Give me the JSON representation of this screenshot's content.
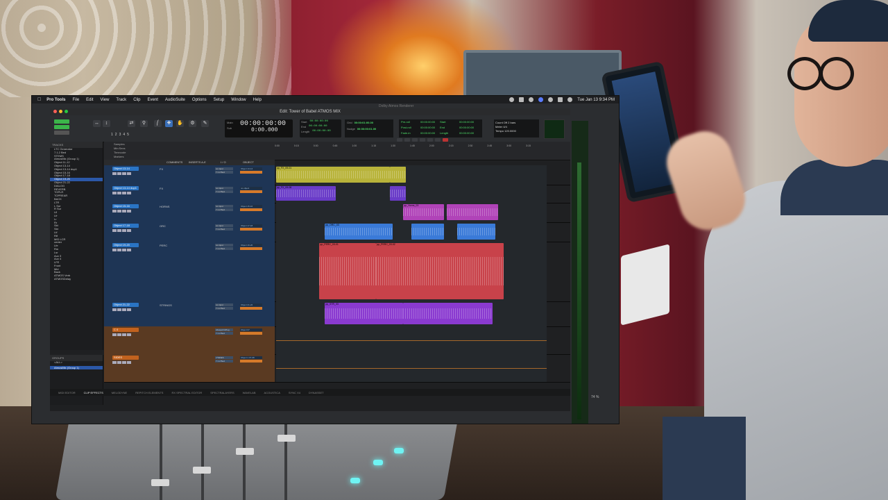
{
  "menubar": {
    "app": "Pro Tools",
    "items": [
      "File",
      "Edit",
      "View",
      "Track",
      "Clip",
      "Event",
      "AudioSuite",
      "Options",
      "Setup",
      "Window",
      "Help"
    ],
    "clock": "Tue Jan 13  9:34 PM"
  },
  "renderer_label": "Dolby Atmos Renderer",
  "window_title": "Edit: Tower of Babel ATMOS MIX",
  "toolbar": {
    "zoom_presets": [
      "1",
      "2",
      "3",
      "4",
      "5"
    ],
    "counter": {
      "main_label": "Main",
      "sub_label": "Sub",
      "main": "00:00:00:00",
      "sub": "0:00.000",
      "cursor_label": "Cursor",
      "cursor": "00:00:19:05.39"
    },
    "selection": [
      {
        "label": "Start",
        "value": "00:00:00:00"
      },
      {
        "label": "End",
        "value": "00:00:00:00"
      },
      {
        "label": "Length",
        "value": "00:00:00:00"
      }
    ],
    "grid": {
      "label": "Grid",
      "value": "00:00:01:00.00"
    },
    "nudge": {
      "label": "Nudge",
      "value": "00:00:00:01.00"
    },
    "prepost": [
      {
        "a": "Pre-roll",
        "b": "00:00:00:00",
        "c": "Start",
        "d": "00:00:00:00"
      },
      {
        "a": "Post-roll",
        "b": "00:00:00:00",
        "c": "End",
        "d": "00:00:00:00"
      },
      {
        "a": "Fade-in",
        "b": "00:00:00:00",
        "c": "Length",
        "d": "00:00:00:00"
      }
    ],
    "countoff": {
      "line1": "Count Off   2 bars",
      "line2": "Meter      4/4",
      "line3": "Tempo    120.0000"
    }
  },
  "tracks_panel": {
    "title": "TRACKS",
    "items": [
      "LTC Generator",
      "7.1.2 Bed",
      "STEMS",
      "AtmosMix (Group 1)",
      "Object 11-12",
      "Object 13-14",
      "Object 13-14 dup1",
      "Object 15-16",
      "Object 17-18",
      "Object 19-20",
      "Object 21-22",
      "DIALOG",
      "REVERB",
      "TOPLR",
      "TOPREAR",
      "BACK",
      "LTR",
      "L Sur",
      "R Sur",
      "Lfl",
      "Lfr",
      "Lr",
      "Rr",
      "Sbl",
      "Sbr",
      "Ltf",
      "Rtf",
      "MID LCR",
      "center",
      "Lfe",
      "Rm",
      "Lsr",
      "Aux 3",
      "Aux 4",
      "LFE",
      "Front",
      "Mid",
      "Back",
      "ATMOS Verb",
      "ATMOSDelay"
    ],
    "selected_index": 9
  },
  "groups_panel": {
    "title": "GROUPS",
    "items": [
      "<ALL>"
    ],
    "selected": "AtmosMix (Group 1)"
  },
  "rulers": {
    "labels": [
      "Samples",
      "Min:Secs",
      "Timecode",
      "Markers"
    ],
    "ticks": [
      "0:00",
      "0:15",
      "0:30",
      "0:45",
      "1:00",
      "1:15",
      "1:30",
      "1:45",
      "2:00",
      "2:15",
      "2:30",
      "2:45",
      "3:00",
      "3:15"
    ]
  },
  "columns": {
    "comments": "COMMENTS",
    "inserts": "INSERTS A-E",
    "io": "I / O",
    "object": "OBJECT"
  },
  "tracks": [
    {
      "name": "Object 13-14",
      "comment": "FX",
      "io": [
        "no input",
        "7.1.2 Bed"
      ],
      "obj": "Object 13-14",
      "clips": [
        {
          "name": "pp_FX_09-01",
          "start": 0,
          "end": 0.42,
          "color": "#b8b33a"
        },
        {
          "name": "",
          "start": 0.42,
          "end": 0.48,
          "color": "#b8b33a"
        }
      ]
    },
    {
      "name": "Object 13-14 dup1",
      "comment": "FX",
      "io": [
        "no input",
        "7.1.2 Bed"
      ],
      "obj": "no object",
      "clips": [
        {
          "name": "pp_FX_09-08",
          "start": 0,
          "end": 0.22,
          "color": "#6a3cc8"
        },
        {
          "name": "",
          "start": 0.42,
          "end": 0.48,
          "color": "#6a3cc8"
        }
      ]
    },
    {
      "name": "Object 15-16",
      "comment": "HORNS",
      "io": [
        "no input",
        "7.1.2 Bed"
      ],
      "obj": "Object 15-16",
      "clips": [
        {
          "name": "pp_Horns_03",
          "start": 0.47,
          "end": 0.62,
          "color": "#b043b8"
        },
        {
          "name": "",
          "start": 0.63,
          "end": 0.82,
          "color": "#b043b8"
        }
      ]
    },
    {
      "name": "Object 17-18",
      "comment": "ORC",
      "io": [
        "no input",
        "7.1.2 Bed"
      ],
      "obj": "Object 17-18",
      "clips": [
        {
          "name": "pp_ORC_03",
          "start": 0.18,
          "end": 0.43,
          "color": "#3a7ad8"
        },
        {
          "name": "",
          "start": 0.5,
          "end": 0.62,
          "color": "#3a7ad8"
        },
        {
          "name": "",
          "start": 0.67,
          "end": 0.81,
          "color": "#3a7ad8"
        }
      ]
    },
    {
      "name": "Object 19-20",
      "comment": "PERC",
      "io": [
        "no input",
        "7.1.2 Bed"
      ],
      "obj": "Object 19-20",
      "clips": [
        {
          "name": "pp_PERC_03-01",
          "start": 0.16,
          "end": 0.37,
          "color": "#c8424a"
        },
        {
          "name": "pp_PERC_03-02",
          "start": 0.37,
          "end": 0.84,
          "color": "#c8424a"
        }
      ]
    },
    {
      "name": "Object 21-22",
      "comment": "STRINGS",
      "io": [
        "no input",
        "7.1.2 Bed"
      ],
      "obj": "Object 21-22",
      "clips": [
        {
          "name": "pp_STR_03",
          "start": 0.18,
          "end": 0.47,
          "color": "#8a3ad0"
        },
        {
          "name": "",
          "start": 0.47,
          "end": 0.8,
          "color": "#8a3ad0"
        }
      ]
    },
    {
      "name": "C 0",
      "comment": "",
      "io": [
        "AlwaysOnPlug",
        "7.1.2 Bed"
      ],
      "obj": "Object 07",
      "clips": []
    },
    {
      "name": "SIDES",
      "comment": "",
      "io": [
        "s*SIDES",
        "7.1.2 Bed"
      ],
      "obj": "Object 1 07-08",
      "clips": []
    }
  ],
  "bottom_tabs": [
    "MIDI EDITOR",
    "CLIP EFFECTS",
    "MELODYNE",
    "REPITCH ELEMENTS",
    "RX SPECTRAL EDITOR",
    "SPECTRALAYERS",
    "WAVELAB",
    "ACOUSTICA",
    "SYNC X4",
    "DYNASSET"
  ],
  "bottom_active": "CLIP EFFECTS",
  "zoom_level": "74 %",
  "colors": {
    "accent": "#2b58a8",
    "record": "#b33",
    "green": "#4ee06a"
  }
}
